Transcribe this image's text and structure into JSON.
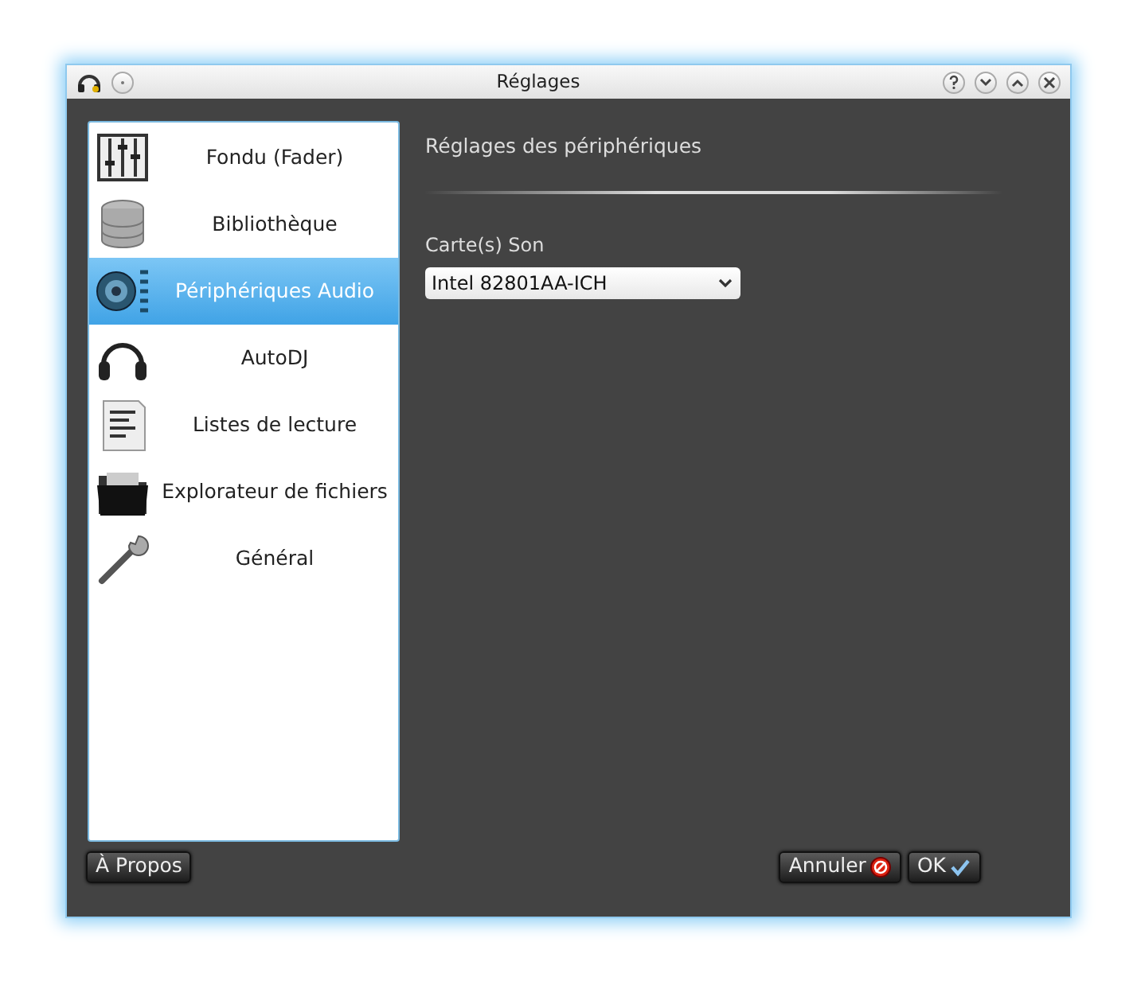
{
  "window": {
    "title": "Réglages"
  },
  "sidebar": {
    "items": [
      {
        "label": "Fondu (Fader)",
        "selected": false
      },
      {
        "label": "Bibliothèque",
        "selected": false
      },
      {
        "label": "Périphériques Audio",
        "selected": true
      },
      {
        "label": "AutoDJ",
        "selected": false
      },
      {
        "label": "Listes de lecture",
        "selected": false
      },
      {
        "label": "Explorateur de fichiers",
        "selected": false
      },
      {
        "label": "Général",
        "selected": false
      }
    ]
  },
  "panel": {
    "heading": "Réglages des périphériques",
    "sound_card_label": "Carte(s) Son",
    "sound_card_value": "Intel 82801AA-ICH"
  },
  "buttons": {
    "about": "À Propos",
    "cancel": "Annuler",
    "ok": "OK"
  }
}
